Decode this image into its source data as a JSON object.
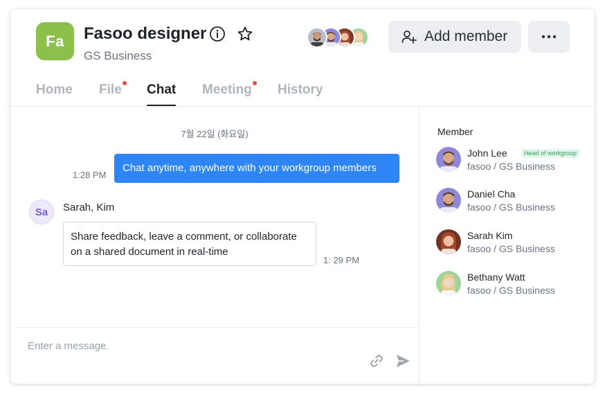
{
  "header": {
    "logo_text": "Fa",
    "logo_color": "#8cc04a",
    "title": "Fasoo designer",
    "subtitle": "GS Business",
    "add_member_label": "Add member"
  },
  "tabs": [
    {
      "label": "Home",
      "active": false,
      "has_dot": false
    },
    {
      "label": "File",
      "active": false,
      "has_dot": true
    },
    {
      "label": "Chat",
      "active": true,
      "has_dot": false
    },
    {
      "label": "Meeting",
      "active": false,
      "has_dot": true
    },
    {
      "label": "History",
      "active": false,
      "has_dot": false
    }
  ],
  "chat": {
    "date_label": "7월 22일 (화요일)",
    "outgoing": {
      "time": "1:28 PM",
      "text": "Chat anytime, anywhere with your workgroup members"
    },
    "incoming": {
      "sender_initials": "Sa",
      "sender_name": "Sarah, Kim",
      "line1": "Share feedback, leave a comment, or collaborate",
      "line2": "on a shared document in real-time",
      "time": "1: 29 PM"
    },
    "input_placeholder": "Enter a message."
  },
  "members": {
    "title": "Member",
    "list": [
      {
        "name": "John Lee",
        "org": "fasoo / GS Business",
        "badge": "Head of workgroup"
      },
      {
        "name": "Daniel Cha",
        "org": "fasoo / GS Business"
      },
      {
        "name": "Sarah Kim",
        "org": "fasoo / GS Business"
      },
      {
        "name": "Bethany Watt",
        "org": "fasoo / GS Business"
      }
    ]
  },
  "colors": {
    "accent_blue": "#2e86f6",
    "notification_dot": "#e84b3c",
    "badge_green": "#2e9e5a"
  }
}
